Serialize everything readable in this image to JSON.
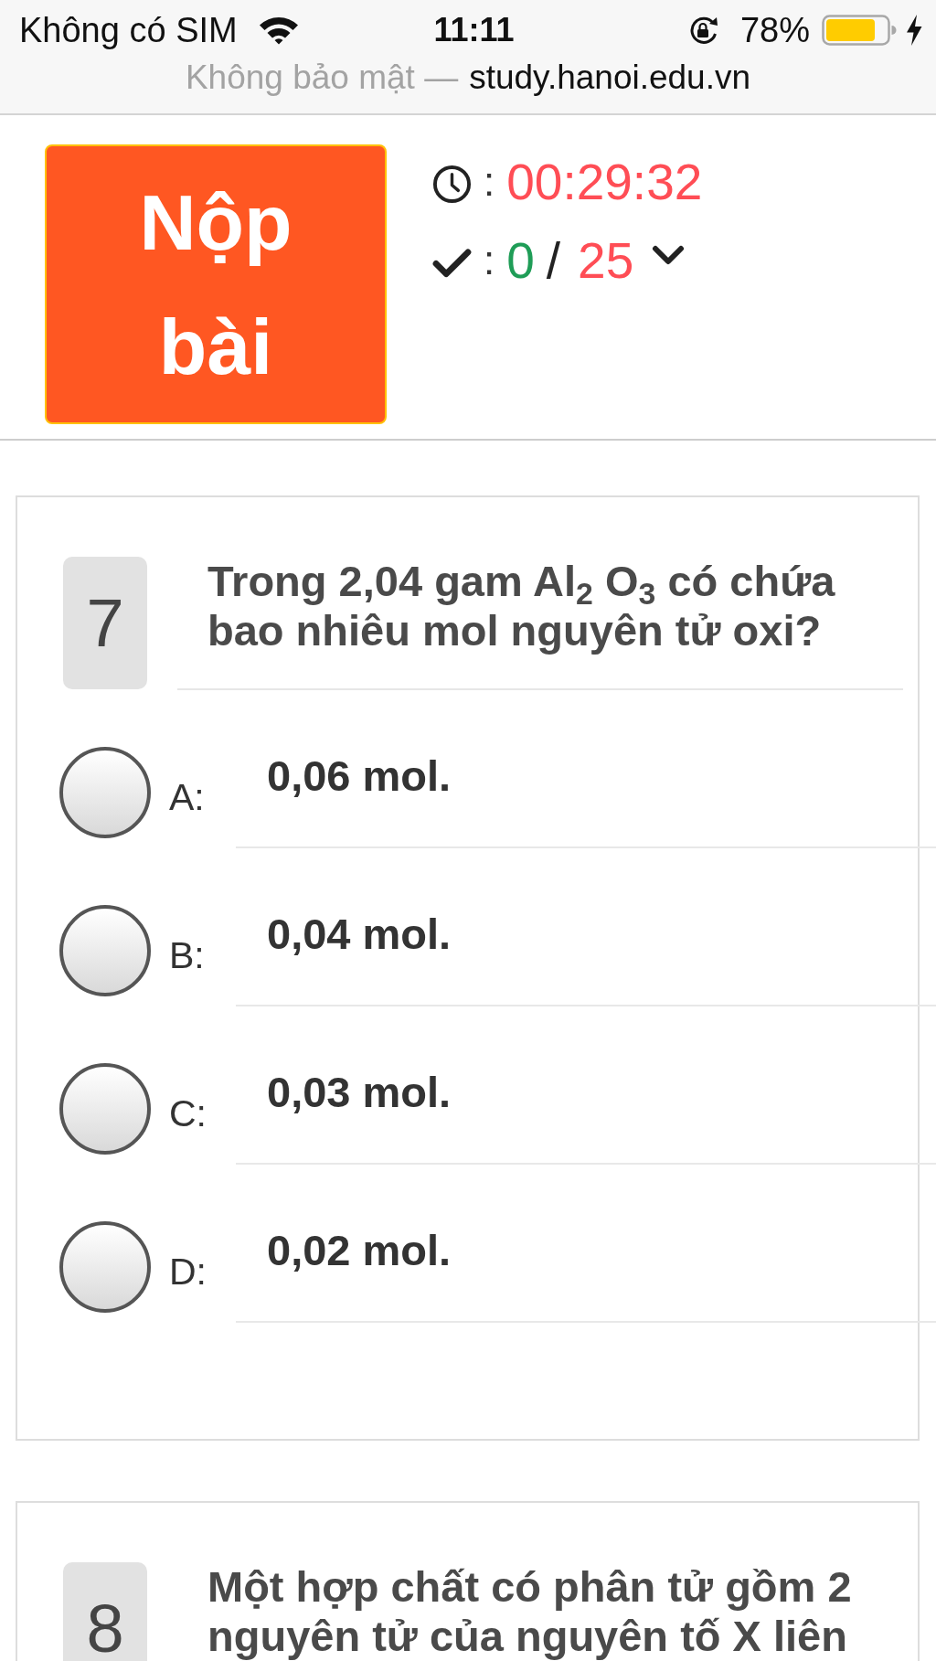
{
  "status_bar": {
    "carrier": "Không có SIM",
    "time": "11:11",
    "battery": "78%",
    "charging": true
  },
  "address_bar": {
    "security_note": "Không bảo mật —",
    "url": "study.hanoi.edu.vn"
  },
  "header": {
    "submit_button": "Nộp bài",
    "timer": {
      "separator": ":",
      "value": "00:29:32"
    },
    "progress": {
      "separator": ":",
      "answered": "0",
      "slash": "/",
      "total": "25"
    }
  },
  "questions": [
    {
      "number": "7",
      "text": "Trong 2,04 gam Al$_{2}$ O$_{3}$ có chứa bao nhiêu mol nguyên tử oxi?",
      "options": [
        {
          "label": "A:",
          "text": "0,06 mol.",
          "selected": false
        },
        {
          "label": "B:",
          "text": "0,04 mol.",
          "selected": false
        },
        {
          "label": "C:",
          "text": "0,03 mol.",
          "selected": false
        },
        {
          "label": "D:",
          "text": "0,02 mol.",
          "selected": false
        }
      ]
    },
    {
      "number": "8",
      "text": "Một hợp chất có phân tử gồm 2 nguyên tử của nguyên tố X liên"
    }
  ]
}
